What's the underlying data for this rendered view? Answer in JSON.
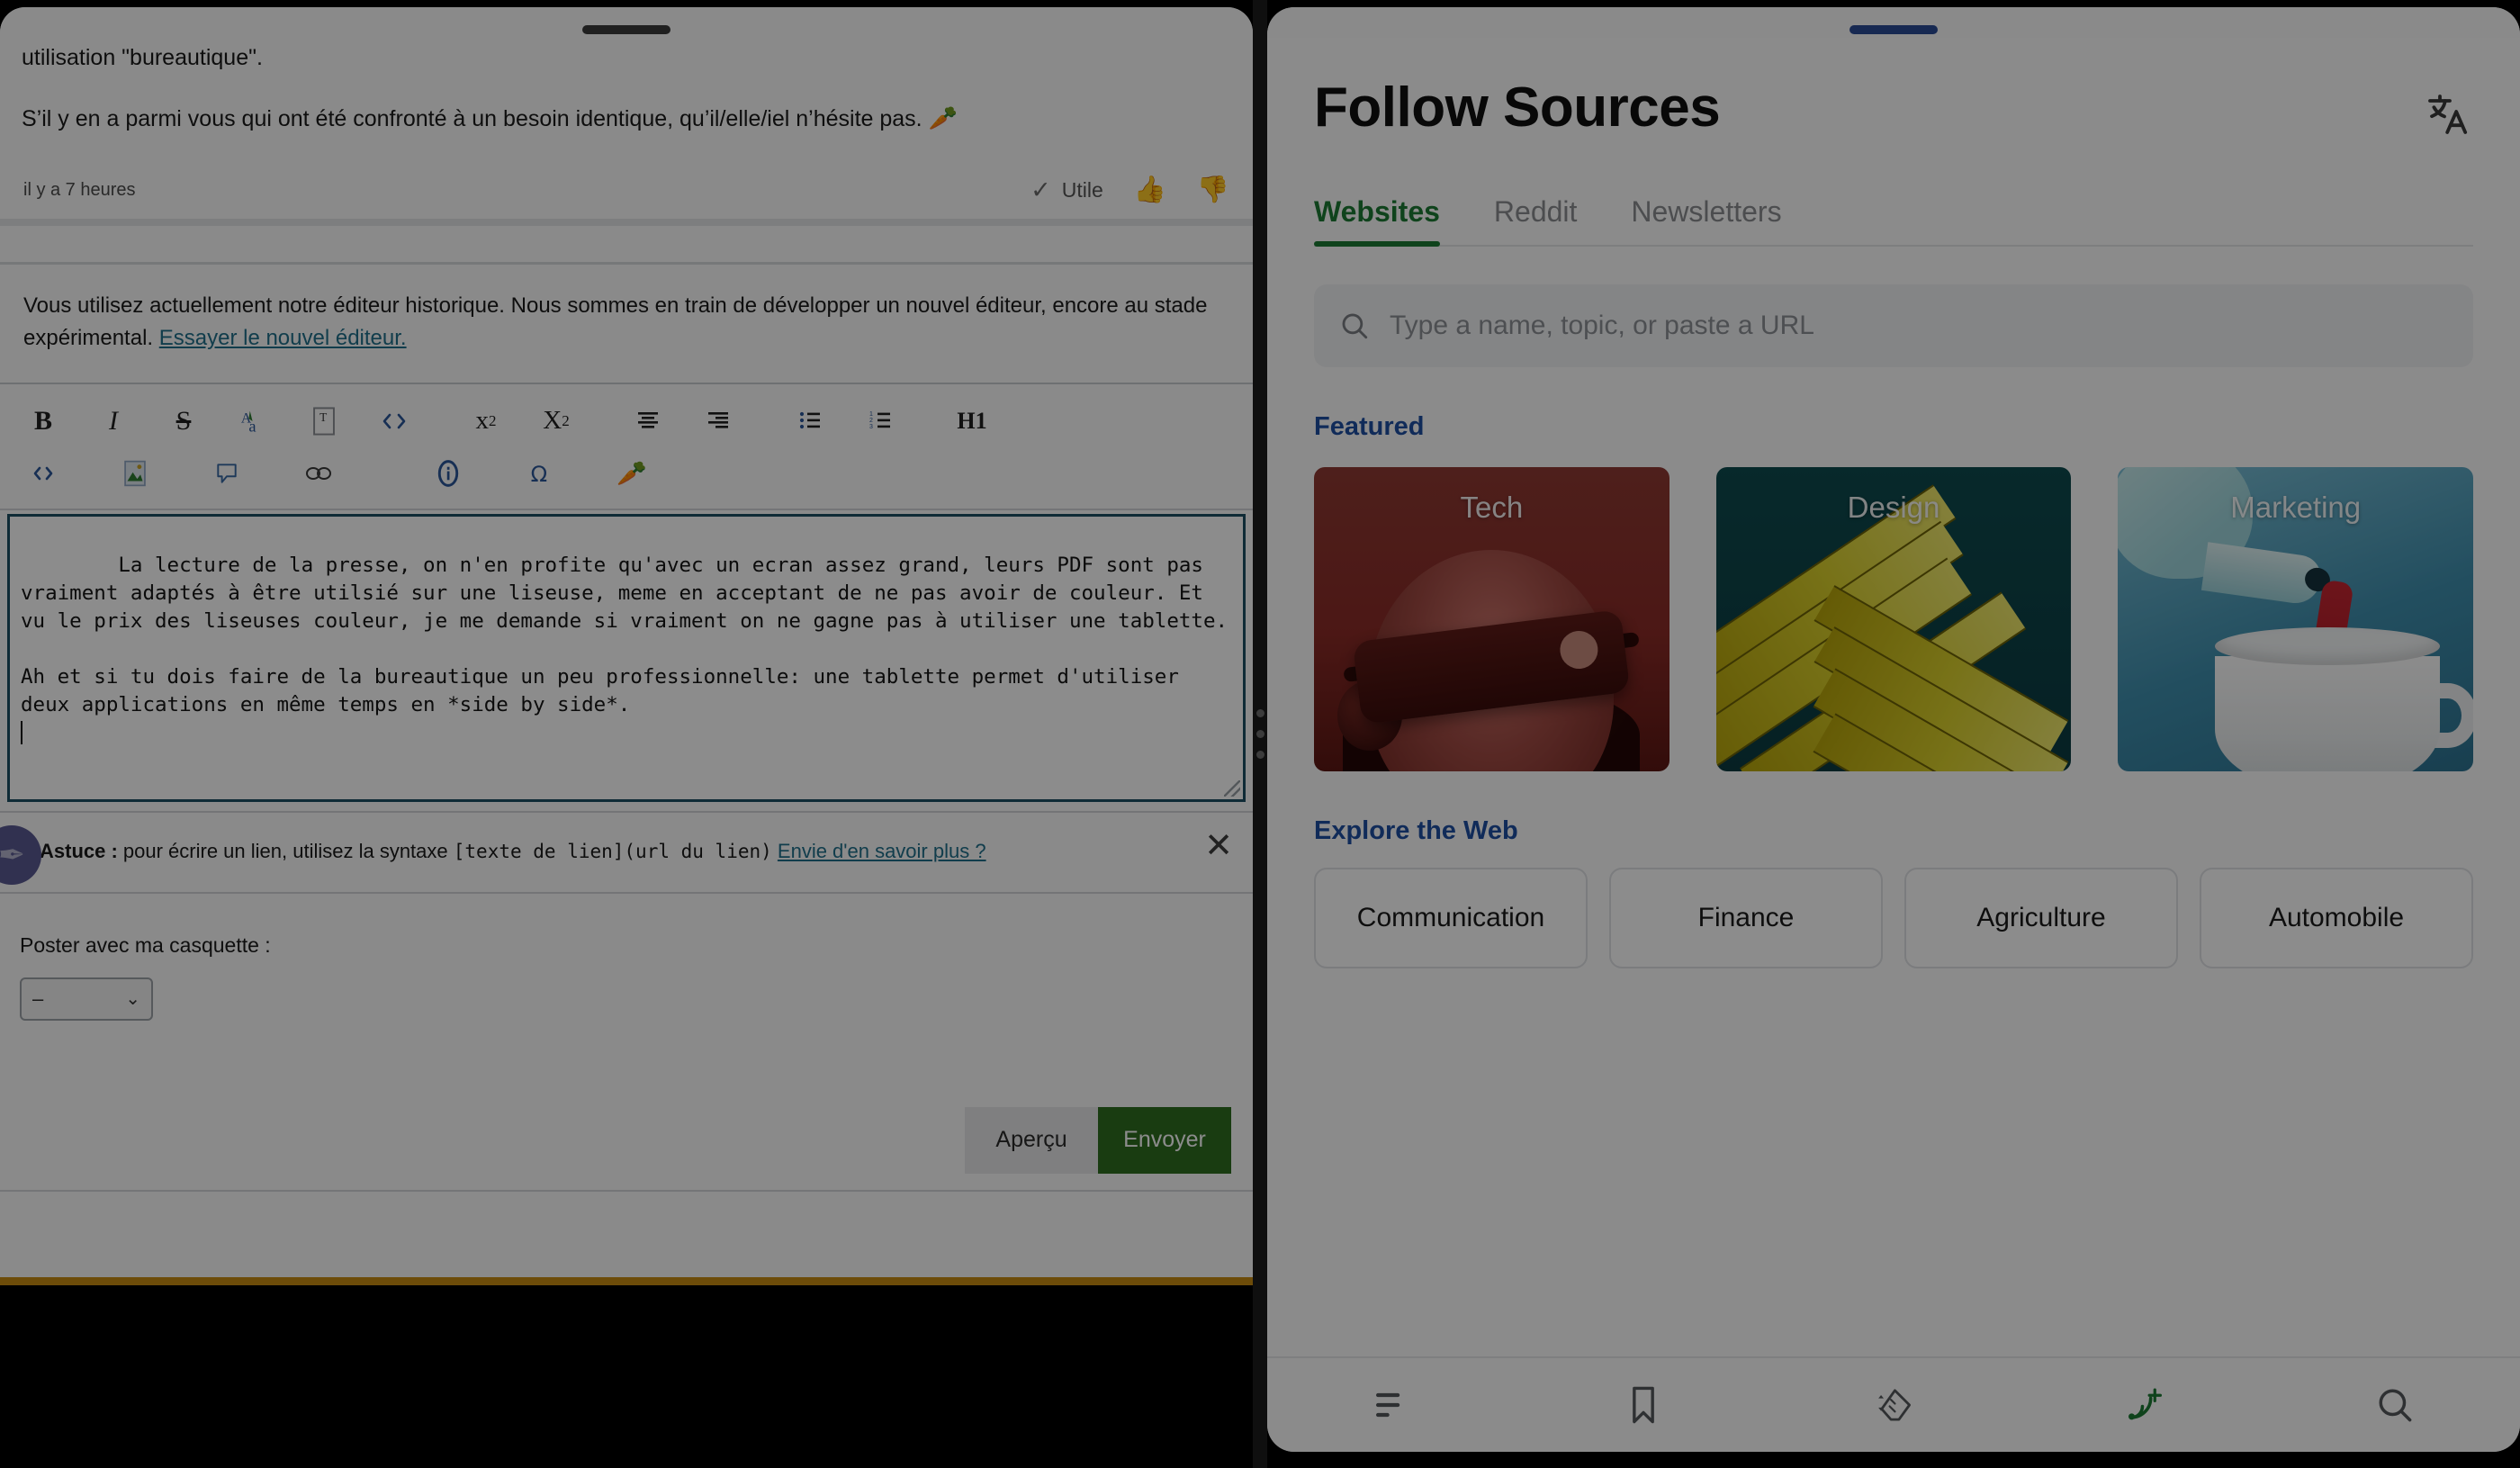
{
  "left_panel": {
    "handle": "drag-handle",
    "comment": {
      "tail_text": "utilisation \"bureautique\".",
      "paragraph": "S’il y en a parmi vous qui ont été confronté à un besoin identique, qu’il/elle/iel n’hésite pas.",
      "emoji": "🥕",
      "date": "il y a 7 heures",
      "useful_label": "Utile",
      "thumb_up": "👍",
      "thumb_down": "👎",
      "check": "✓"
    },
    "editor_notice": {
      "text": "Vous utilisez actuellement notre éditeur historique. Nous sommes en train de développer un nouvel éditeur, encore au stade expérimental.",
      "link": "Essayer le nouvel éditeur."
    },
    "toolbar": {
      "row1": [
        {
          "name": "bold-button",
          "glyph": "B",
          "style": "tb-bold",
          "color": "dark"
        },
        {
          "name": "italic-button",
          "glyph": "I",
          "style": "tb-ital",
          "color": "dark"
        },
        {
          "name": "strikethrough-button",
          "glyph": "S",
          "style": "tb-strike",
          "color": "dark"
        },
        {
          "name": "text-color-button",
          "glyph": "Aa",
          "style": "tb-serif",
          "color": "blue"
        },
        {
          "name": "text-box-button",
          "glyph": "T",
          "style": "tb-serif",
          "color": "dark"
        },
        {
          "name": "inline-code-button",
          "glyph": "<>",
          "style": "",
          "color": "blue"
        },
        {
          "name": "superscript-button",
          "glyph": "x",
          "style": "tb-serif",
          "color": "dark"
        },
        {
          "name": "subscript-button",
          "glyph": "x",
          "style": "tb-serif",
          "color": "dark"
        },
        {
          "name": "align-center-button",
          "glyph": "≡",
          "style": "",
          "color": "dark"
        },
        {
          "name": "align-right-button",
          "glyph": "≡",
          "style": "",
          "color": "dark"
        },
        {
          "name": "bullet-list-button",
          "glyph": "•≡",
          "style": "",
          "color": "blue"
        },
        {
          "name": "numbered-list-button",
          "glyph": "1≡",
          "style": "",
          "color": "blue"
        },
        {
          "name": "heading-1-button",
          "glyph": "H1",
          "style": "tb-h1",
          "color": "dark"
        }
      ],
      "row2": [
        {
          "name": "code-block-button",
          "glyph": "<>",
          "style": "",
          "color": "blue"
        },
        {
          "name": "insert-image-button",
          "glyph": "🖼",
          "style": "",
          "color": "blue"
        },
        {
          "name": "quote-button",
          "glyph": "🗨",
          "style": "",
          "color": "blue"
        },
        {
          "name": "link-button",
          "glyph": "🔗",
          "style": "",
          "color": "dark"
        },
        {
          "name": "info-button",
          "glyph": "ⓘ",
          "style": "",
          "color": "blue"
        },
        {
          "name": "special-character-button",
          "glyph": "Ω",
          "style": "",
          "color": "blue"
        },
        {
          "name": "emoji-button",
          "glyph": "🥕",
          "style": "",
          "color": "dark"
        }
      ]
    },
    "textarea": {
      "value": "La lecture de la presse, on n'en profite qu'avec un ecran assez grand, leurs PDF sont pas vraiment adaptés à être utilsié sur une liseuse, meme en acceptant de ne pas avoir de couleur. Et vu le prix des liseuses couleur, je me demande si vraiment on ne gagne pas à utiliser une tablette.\n\nAh et si tu dois faire de la bureautique un peu professionnelle: une tablette permet d'utiliser deux applications en même temps en *side by side*.\n"
    },
    "tip": {
      "label": "Astuce :",
      "text_before": " pour écrire un lien, utilisez la syntaxe ",
      "code": "[texte de lien](url du lien)",
      "link": "Envie d'en savoir plus ?",
      "close": "✕"
    },
    "form": {
      "cap_label": "Poster avec ma casquette :",
      "cap_value": "–",
      "chevron": "⌄",
      "preview_button": "Aperçu",
      "submit_button": "Envoyer"
    }
  },
  "divider": {
    "name": "split-screen-divider"
  },
  "right_panel": {
    "handle": "drag-handle",
    "title": "Follow Sources",
    "translate_icon": "translate-icon",
    "tabs": [
      {
        "label": "Websites",
        "active": true
      },
      {
        "label": "Reddit",
        "active": false
      },
      {
        "label": "Newsletters",
        "active": false
      }
    ],
    "search": {
      "placeholder": "Type a name, topic, or paste a URL",
      "value": ""
    },
    "featured": {
      "heading": "Featured",
      "cards": [
        {
          "label": "Tech",
          "theme": "red"
        },
        {
          "label": "Design",
          "theme": "teal"
        },
        {
          "label": "Marketing",
          "theme": "blue"
        }
      ]
    },
    "explore": {
      "heading": "Explore the Web",
      "chips": [
        "Communication",
        "Finance",
        "Agriculture",
        "Automobile"
      ]
    },
    "bottom_nav": [
      {
        "name": "menu-icon",
        "active": false
      },
      {
        "name": "bookmark-icon",
        "active": false
      },
      {
        "name": "feedly-leaf-icon",
        "active": false
      },
      {
        "name": "add-feed-icon",
        "active": true
      },
      {
        "name": "search-icon",
        "active": false
      }
    ]
  },
  "colors": {
    "accent_green": "#1d7a33",
    "accent_blue": "#1e4fa3",
    "submit_green": "#2f6d20",
    "link_teal": "#1f6f8b",
    "bottom_bar_orange": "#c78b12"
  }
}
